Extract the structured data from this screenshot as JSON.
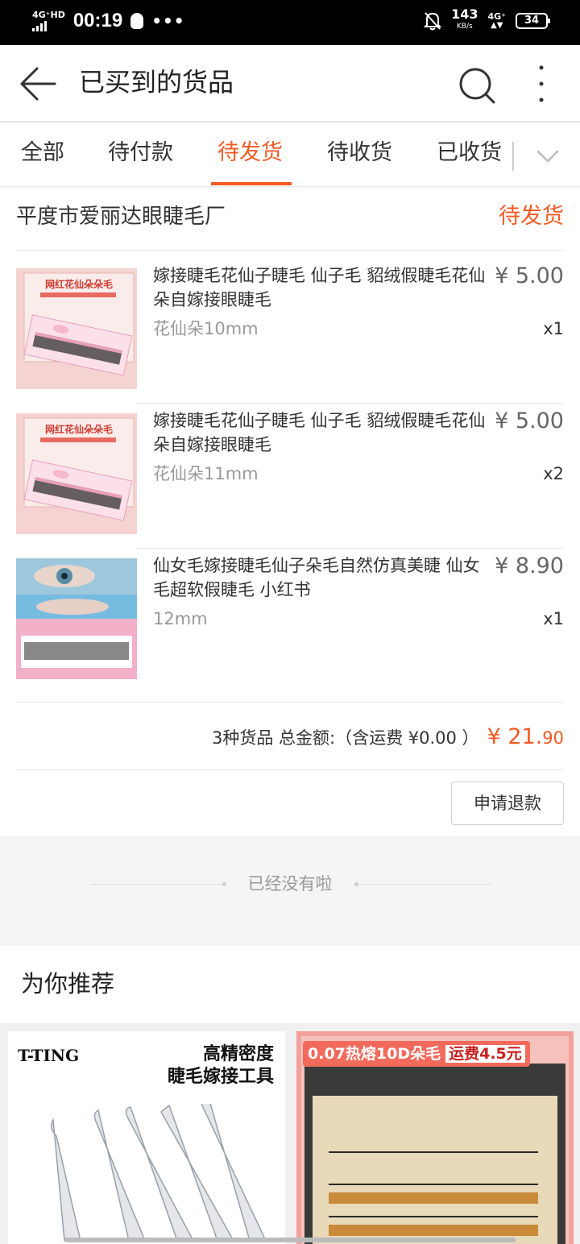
{
  "status_bar": {
    "network": "4G⁺HD",
    "time": "00:19",
    "more": "•••",
    "speed_value": "143",
    "speed_unit": "KB/s",
    "net2": "4G⁺",
    "battery": "34"
  },
  "header": {
    "title": "已买到的货品"
  },
  "tabs": [
    {
      "label": "全部"
    },
    {
      "label": "待付款"
    },
    {
      "label": "待发货"
    },
    {
      "label": "待收货"
    },
    {
      "label": "已收货"
    }
  ],
  "active_tab": 2,
  "order": {
    "shop": "平度市爱丽达眼睫毛厂",
    "status": "待发货",
    "items": [
      {
        "name": "嫁接睫毛花仙子睫毛 仙子毛 貂绒假睫毛花仙朵自嫁接眼睫毛",
        "price": "¥ 5.00",
        "sku": "花仙朵10mm",
        "qty": "x1",
        "image_label": "网红花仙朵朵毛"
      },
      {
        "name": "嫁接睫毛花仙子睫毛 仙子毛 貂绒假睫毛花仙朵自嫁接眼睫毛",
        "price": "¥ 5.00",
        "sku": "花仙朵11mm",
        "qty": "x2",
        "image_label": "网红花仙朵朵毛"
      },
      {
        "name": "仙女毛嫁接睫毛仙子朵毛自然仿真美睫 仙女毛超软假睫毛 小红书",
        "price": "¥ 8.90",
        "sku": "12mm",
        "qty": "x1"
      }
    ],
    "summary": "3种货品 总金额:（含运费 ¥0.00 ）",
    "total_main": "¥ 21.",
    "total_cents": "90",
    "refund_label": "申请退款"
  },
  "no_more": "已经没有啦",
  "recommend": {
    "title": "为你推荐",
    "cards": [
      {
        "brand": "T-TING",
        "headline1": "高精密度",
        "headline2": "睫毛嫁接工具"
      },
      {
        "banner": "0.07热熔10D朵毛",
        "shipping": "运费4.5元"
      }
    ]
  },
  "colors": {
    "accent": "#f25a23",
    "text": "#333333",
    "muted": "#999999",
    "divider": "#e8e8e8"
  }
}
